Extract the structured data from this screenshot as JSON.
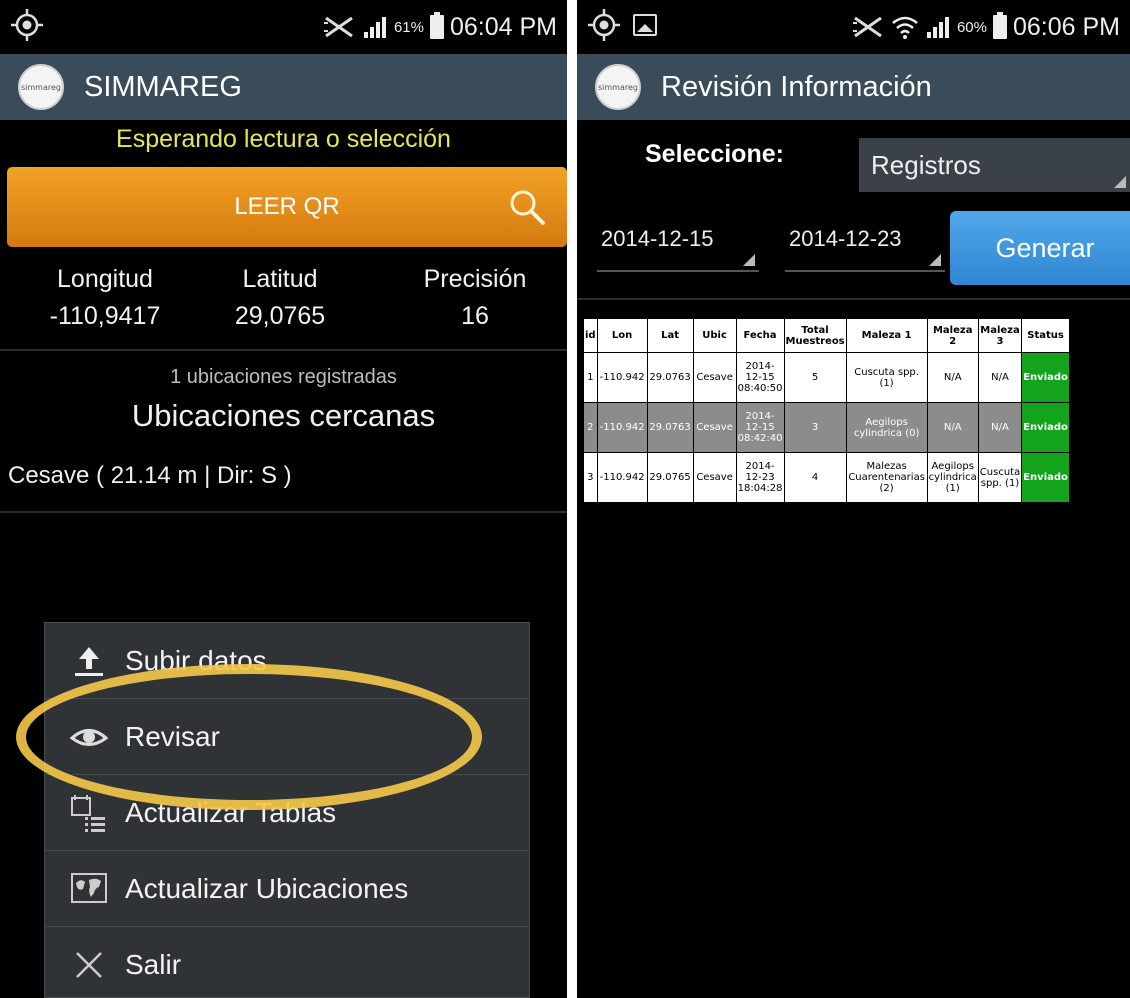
{
  "left": {
    "status": {
      "percent": "61%",
      "time": "06:04 PM"
    },
    "app_title": "SIMMAREG",
    "logo_text": "simmareg",
    "waiting_text": "Esperando lectura o selección",
    "qr_button": "LEER QR",
    "coords": [
      {
        "label": "Longitud",
        "value": "-110,9417"
      },
      {
        "label": "Latitud",
        "value": "29,0765"
      },
      {
        "label": "Precisión",
        "value": "16"
      }
    ],
    "registered_count": "1 ubicaciones registradas",
    "nearby_title": "Ubicaciones cercanas",
    "nearby_item": "Cesave ( 21.14 m | Dir: S )",
    "menu": [
      {
        "label": "Subir datos",
        "icon": "upload-icon"
      },
      {
        "label": "Revisar",
        "icon": "eye-icon"
      },
      {
        "label": "Actualizar Tablas",
        "icon": "calendar-list-icon"
      },
      {
        "label": "Actualizar Ubicaciones",
        "icon": "map-icon"
      },
      {
        "label": "Salir",
        "icon": "close-icon"
      }
    ]
  },
  "right": {
    "status": {
      "percent": "60%",
      "time": "06:06 PM"
    },
    "app_title": "Revisión Información",
    "logo_text": "simmareg",
    "select_label": "Seleccione:",
    "select_value": "Registros",
    "date_from": "2014-12-15",
    "date_to": "2014-12-23",
    "generate_button": "Generar",
    "table": {
      "headers": [
        "id",
        "Lon",
        "Lat",
        "Ubic",
        "Fecha",
        "Total Muestreos",
        "Maleza 1",
        "Maleza 2",
        "Maleza 3",
        "Status"
      ],
      "rows": [
        [
          "1",
          "-110.942",
          "29.0763",
          "Cesave",
          "2014-12-15 08:40:50",
          "5",
          "Cuscuta spp. (1)",
          "N/A",
          "N/A",
          "Enviado"
        ],
        [
          "2",
          "-110.942",
          "29.0763",
          "Cesave",
          "2014-12-15 08:42:40",
          "3",
          "Aegilops cylindrica (0)",
          "N/A",
          "N/A",
          "Enviado"
        ],
        [
          "3",
          "-110.942",
          "29.0765",
          "Cesave",
          "2014-12-23 18:04:28",
          "4",
          "Malezas Cuarentenarias (2)",
          "Aegilops cylindrica (1)",
          "Cuscuta spp. (1)",
          "Enviado"
        ]
      ]
    }
  },
  "colors": {
    "appbar": "#3a4b59",
    "waiting_text": "#e6e651",
    "qr_button": "#e88f1a",
    "generate_button": "#3f97de",
    "highlight_ring": "#f6c94a",
    "status_ok": "#13a31c"
  }
}
